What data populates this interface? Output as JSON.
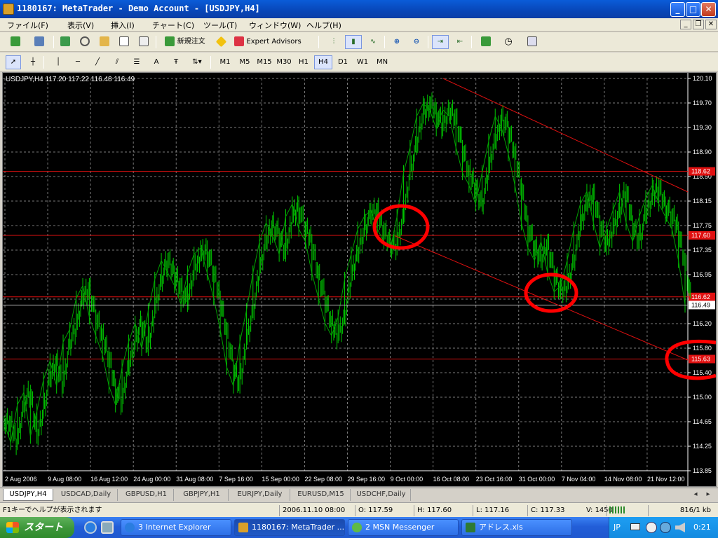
{
  "window": {
    "title": "1180167: MetaTrader - Demo Account - [USDJPY,H4]",
    "min": "_",
    "max": "□",
    "close": "✕"
  },
  "menu": [
    "ファイル(F)",
    "表示(V)",
    "挿入(I)",
    "チャート(C)",
    "ツール(T)",
    "ウィンドウ(W)",
    "ヘルプ(H)"
  ],
  "toolbar1": {
    "new_order": "新規注文",
    "expert_advisors": "Expert Advisors"
  },
  "toolbar2": {
    "text_tool": "A",
    "timeframes": [
      "M1",
      "M5",
      "M15",
      "M30",
      "H1",
      "H4",
      "D1",
      "W1",
      "MN"
    ],
    "active_timeframe": "H4"
  },
  "chart_data": {
    "type": "line",
    "symbol_info": "USDJPY,H4  117.20 117.22 116.48 116.49",
    "x_ticks": [
      "2 Aug 2006",
      "9 Aug 08:00",
      "16 Aug 12:00",
      "24 Aug 00:00",
      "31 Aug 08:00",
      "7 Sep 16:00",
      "15 Sep 00:00",
      "22 Sep 08:00",
      "29 Sep 16:00",
      "9 Oct 00:00",
      "16 Oct 08:00",
      "23 Oct 16:00",
      "31 Oct 00:00",
      "7 Nov 04:00",
      "14 Nov 08:00",
      "21 Nov 12:00"
    ],
    "y_ticks": [
      "120.10",
      "119.70",
      "119.30",
      "118.90",
      "118.50",
      "118.15",
      "117.75",
      "117.35",
      "116.95",
      "116.55",
      "116.20",
      "115.80",
      "115.40",
      "115.00",
      "114.65",
      "114.25",
      "113.85"
    ],
    "ylim": [
      113.85,
      120.1
    ],
    "current_price": "116.49",
    "price_levels": [
      {
        "value": 118.62,
        "label": "118.62"
      },
      {
        "value": 117.6,
        "label": "117.60"
      },
      {
        "value": 116.62,
        "label": "116.62"
      },
      {
        "value": 115.63,
        "label": "115.63"
      }
    ],
    "series": [
      {
        "values": [
          114.6,
          114.3,
          114.9,
          115.1,
          114.4,
          114.8,
          115.3,
          115.6,
          115.2,
          115.9,
          116.1,
          116.6,
          116.8,
          116.3,
          116.0,
          115.7,
          115.2,
          114.9,
          115.5,
          115.9,
          116.2,
          115.8,
          116.4,
          116.9,
          117.2,
          117.0,
          116.8,
          116.5,
          117.0,
          117.3,
          117.4,
          117.0,
          116.6,
          116.1,
          115.5,
          115.2,
          115.9,
          116.4,
          117.0,
          117.5,
          117.8,
          117.6,
          117.3,
          117.9,
          118.1,
          117.7,
          117.5,
          117.0,
          116.6,
          116.2,
          116.0,
          116.3,
          116.9,
          117.3,
          117.7,
          117.9,
          118.0,
          117.7,
          117.5,
          117.4,
          117.9,
          118.6,
          119.0,
          119.5,
          119.7,
          119.6,
          119.3,
          119.6,
          119.5,
          119.0,
          118.6,
          118.4,
          118.1,
          118.6,
          119.1,
          119.5,
          119.3,
          118.9,
          118.4,
          117.8,
          117.4,
          117.2,
          117.5,
          117.0,
          116.7,
          116.8,
          117.2,
          117.7,
          118.1,
          118.3,
          117.8,
          117.4,
          117.7,
          118.0,
          118.3,
          117.8,
          117.5,
          117.9,
          118.2,
          118.4,
          118.1,
          117.9,
          117.7,
          117.2,
          116.49
        ]
      }
    ]
  },
  "annotation_color": "#ff0000",
  "tabs": [
    "USDJPY,H4",
    "USDCAD,Daily",
    "GBPUSD,H1",
    "GBPJPY,H1",
    "EURJPY,Daily",
    "EURUSD,M15",
    "USDCHF,Daily"
  ],
  "status": {
    "help": "F1キーでヘルプが表示されます",
    "datetime": "2006.11.10 08:00",
    "open": "O: 117.59",
    "high": "H: 117.60",
    "low": "L: 117.16",
    "close": "C: 117.33",
    "volume": "V: 1450",
    "traffic": "816/1 kb"
  },
  "taskbar": {
    "start": "スタート",
    "items": [
      "3 Internet Explorer",
      "1180167: MetaTrader ...",
      "2 MSN Messenger",
      "アドレス.xls"
    ],
    "lang": "JP",
    "clock": "0:21"
  }
}
